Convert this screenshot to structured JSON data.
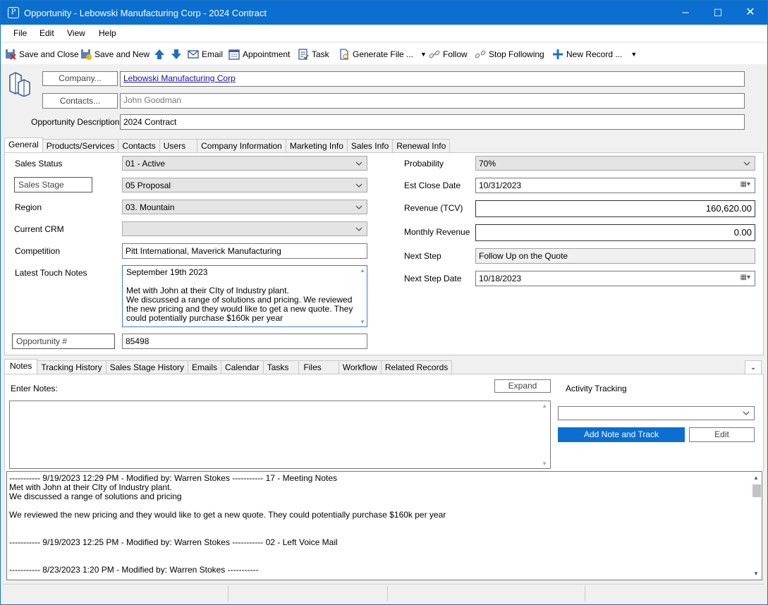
{
  "window": {
    "title": "Opportunity - Lebowski Manufacturing Corp - 2024 Contract",
    "app_icon": "app-logo-icon",
    "minimize": "–",
    "maximize": "☐",
    "close": "✕"
  },
  "menu": [
    "File",
    "Edit",
    "View",
    "Help"
  ],
  "toolbar": {
    "save_close": "Save and Close",
    "save_new": "Save and New",
    "email": "Email",
    "appointment": "Appointment",
    "task": "Task",
    "generate_file": "Generate File ...",
    "follow": "Follow",
    "stop_following": "Stop Following",
    "new_record": "New Record ..."
  },
  "header": {
    "company_btn": "Company...",
    "company_value": "Lebowski Manufacturing Corp",
    "contacts_btn": "Contacts...",
    "contacts_value": "John Goodman",
    "desc_label": "Opportunity Description",
    "desc_value": "2024 Contract"
  },
  "tabs": [
    "General",
    "Products/Services",
    "Contacts",
    "Users",
    "Company Information",
    "Marketing Info",
    "Sales Info",
    "Renewal Info"
  ],
  "general": {
    "sales_status_label": "Sales Status",
    "sales_status": "01 - Active",
    "sales_stage_label": "Sales Stage",
    "sales_stage": "05 Proposal",
    "region_label": "Region",
    "region": "03. Mountain",
    "current_crm_label": "Current CRM",
    "current_crm": "",
    "competition_label": "Competition",
    "competition": "Pitt International, Maverick Manufacturing",
    "latest_touch_label": "Latest Touch Notes",
    "latest_touch_lines": [
      "September 19th  2023",
      "",
      "Met with John at their CIty of Industry plant.",
      "We discussed a range of solutions and pricing. We reviewed",
      "the new pricing and they would like to get a new quote. They",
      "could potentially purchase $160k per year"
    ],
    "opp_num_label": "Opportunity #",
    "opp_num": "85498",
    "probability_label": "Probability",
    "probability": "70%",
    "est_close_label": "Est Close Date",
    "est_close": "10/31/2023",
    "revenue_label": "Revenue (TCV)",
    "revenue": "160,620.00",
    "monthly_label": "Monthly Revenue",
    "monthly": "0.00",
    "next_step_label": "Next Step",
    "next_step": "Follow Up on the Quote",
    "next_step_date_label": "Next Step Date",
    "next_step_date": "10/18/2023"
  },
  "lower_tabs": [
    "Notes",
    "Tracking History",
    "Sales Stage History",
    "Emails",
    "Calendar",
    "Tasks",
    "Files",
    "Workflow",
    "Related Records"
  ],
  "notes": {
    "enter_label": "Enter Notes:",
    "expand_btn": "Expand",
    "activity_label": "Activity Tracking",
    "add_btn": "Add Note and Track",
    "edit_btn": "Edit",
    "log": [
      "----------- 9/19/2023 12:29 PM - Modified by: Warren Stokes ----------- 17 - Meeting Notes",
      "Met with John at their CIty of Industry plant.",
      "We discussed a range of solutions and pricing",
      "",
      "We reviewed the new pricing and they would like to get a new quote. They could potentially purchase $160k per year",
      "",
      "",
      "----------- 9/19/2023 12:25 PM - Modified by: Warren Stokes ----------- 02 - Left Voice Mail",
      "",
      "",
      "----------- 8/23/2023 1:20 PM - Modified by: Warren Stokes -----------"
    ]
  },
  "colors": {
    "titlebar": "#0a6fd1",
    "primary_button": "#0a6fd1",
    "link": "#1a0dab"
  }
}
